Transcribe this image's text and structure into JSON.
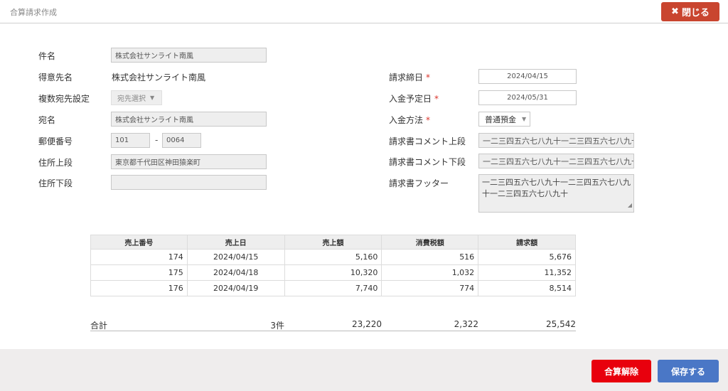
{
  "header": {
    "title": "合算請求作成",
    "close_label": "閉じる",
    "close_icon": "close-icon"
  },
  "left_form": {
    "subject_label": "件名",
    "subject_value": "株式会社サンライト南風",
    "customer_label": "得意先名",
    "customer_value": "株式会社サンライト南風",
    "multi_dest_label": "複数宛先設定",
    "multi_dest_value": "宛先選択",
    "addressee_label": "宛名",
    "addressee_value": "株式会社サンライト南風",
    "postal_label": "郵便番号",
    "postal_1": "101",
    "postal_sep": "-",
    "postal_2": "0064",
    "address1_label": "住所上段",
    "address1_value": "東京都千代田区神田猿楽町",
    "address2_label": "住所下段",
    "address2_value": ""
  },
  "right_form": {
    "closing_label": "請求締日",
    "closing_value": "2024/04/15",
    "payment_due_label": "入金予定日",
    "payment_due_value": "2024/05/31",
    "payment_method_label": "入金方法",
    "payment_method_value": "普通預金",
    "required_mark": "*",
    "comment_top_label": "請求書コメント上段",
    "comment_top_value": "一二三四五六七八九十一二三四五六七八九十",
    "comment_bottom_label": "請求書コメント下段",
    "comment_bottom_value": "一二三四五六七八九十一二三四五六七八九十",
    "footer_label": "請求書フッター",
    "footer_line1": "一二三四五六七八九十一二三四五六七八九",
    "footer_line2": "十一二三四五六七八九十"
  },
  "table": {
    "headers": [
      "売上番号",
      "売上日",
      "売上額",
      "消費税額",
      "請求額"
    ],
    "rows": [
      [
        "174",
        "2024/04/15",
        "5,160",
        "516",
        "5,676"
      ],
      [
        "175",
        "2024/04/18",
        "10,320",
        "1,032",
        "11,352"
      ],
      [
        "176",
        "2024/04/19",
        "7,740",
        "774",
        "8,514"
      ]
    ]
  },
  "totals": {
    "label": "合計",
    "count": "3件",
    "sales": "23,220",
    "tax": "2,322",
    "billing": "25,542"
  },
  "footer": {
    "cancel_label": "合算解除",
    "save_label": "保存する"
  },
  "colors": {
    "close_button": "#c9452f",
    "cancel_button": "#e8000d",
    "save_button": "#4a77c6",
    "required": "#d9342b"
  }
}
